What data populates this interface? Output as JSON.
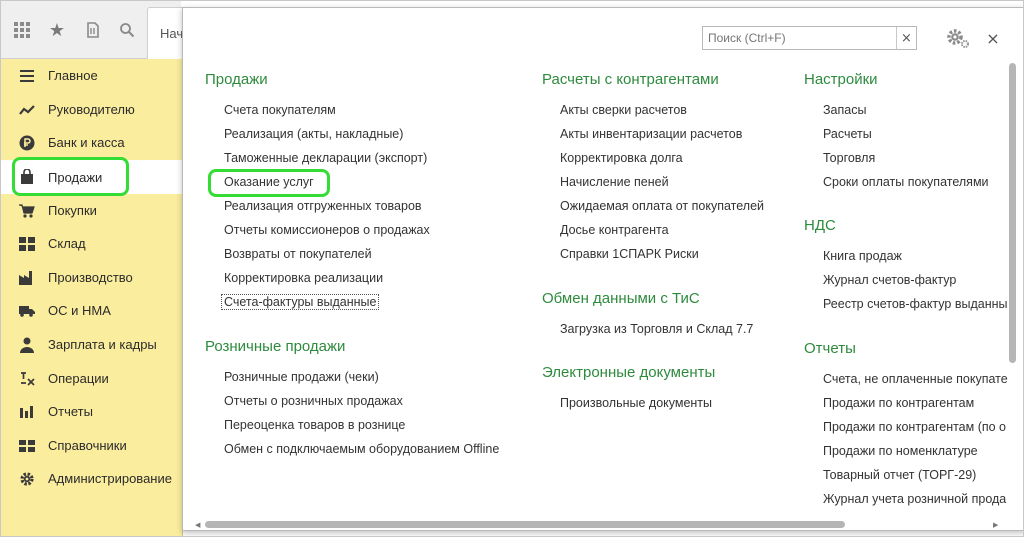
{
  "topbar": {
    "buttons": [
      {
        "icon": "apps-grid-icon"
      },
      {
        "icon": "star-icon"
      },
      {
        "icon": "history-icon"
      },
      {
        "icon": "search-icon"
      }
    ],
    "tab_label": "Нача"
  },
  "sidebar": {
    "items": [
      {
        "label": "Главное",
        "icon": "menu-lines-icon"
      },
      {
        "label": "Руководителю",
        "icon": "trend-chart-icon"
      },
      {
        "label": "Банк и касса",
        "icon": "ruble-coin-icon"
      },
      {
        "label": "Продажи",
        "icon": "shopping-bag-icon",
        "active": true
      },
      {
        "label": "Покупки",
        "icon": "shopping-cart-icon"
      },
      {
        "label": "Склад",
        "icon": "warehouse-icon"
      },
      {
        "label": "Производство",
        "icon": "factory-icon"
      },
      {
        "label": "ОС и НМА",
        "icon": "truck-icon"
      },
      {
        "label": "Зарплата и кадры",
        "icon": "person-icon"
      },
      {
        "label": "Операции",
        "icon": "operations-icon"
      },
      {
        "label": "Отчеты",
        "icon": "bar-chart-icon"
      },
      {
        "label": "Справочники",
        "icon": "book-icon"
      },
      {
        "label": "Администрирование",
        "icon": "gear-icon"
      }
    ]
  },
  "panel": {
    "search_placeholder": "Поиск (Ctrl+F)",
    "search_clear": "×",
    "close": "×",
    "sections": {
      "sales": {
        "title": "Продажи",
        "links": [
          "Счета покупателям",
          "Реализация (акты, накладные)",
          "Таможенные декларации (экспорт)",
          "Оказание услуг",
          "Реализация отгруженных товаров",
          "Отчеты комиссионеров о продажах",
          "Возвраты от покупателей",
          "Корректировка реализации",
          "Счета-фактуры выданные"
        ]
      },
      "retail": {
        "title": "Розничные продажи",
        "links": [
          "Розничные продажи (чеки)",
          "Отчеты о розничных продажах",
          "Переоценка товаров в рознице",
          "Обмен с подключаемым оборудованием Offline"
        ]
      },
      "settlements": {
        "title": "Расчеты с контрагентами",
        "links": [
          "Акты сверки расчетов",
          "Акты инвентаризации расчетов",
          "Корректировка долга",
          "Начисление пеней",
          "Ожидаемая оплата от покупателей",
          "Досье контрагента",
          "Справки 1СПАРК Риски"
        ]
      },
      "exchange": {
        "title": "Обмен данными с ТиС",
        "links": [
          "Загрузка из Торговля и Склад 7.7"
        ]
      },
      "edocs": {
        "title": "Электронные документы",
        "links": [
          "Произвольные документы"
        ]
      },
      "settings": {
        "title": "Настройки",
        "links": [
          "Запасы",
          "Расчеты",
          "Торговля",
          "Сроки оплаты покупателями"
        ]
      },
      "vat": {
        "title": "НДС",
        "links": [
          "Книга продаж",
          "Журнал счетов-фактур",
          "Реестр счетов-фактур выданны"
        ]
      },
      "reports": {
        "title": "Отчеты",
        "links": [
          "Счета, не оплаченные покупате",
          "Продажи по контрагентам",
          "Продажи по контрагентам (по о",
          "Продажи по номенклатуре",
          "Товарный отчет (ТОРГ-29)",
          "Журнал учета розничной прода"
        ]
      }
    }
  },
  "colors": {
    "sidebar_bg": "#fbed9e",
    "section_title": "#2e8b3e",
    "highlight": "#33dd33"
  }
}
